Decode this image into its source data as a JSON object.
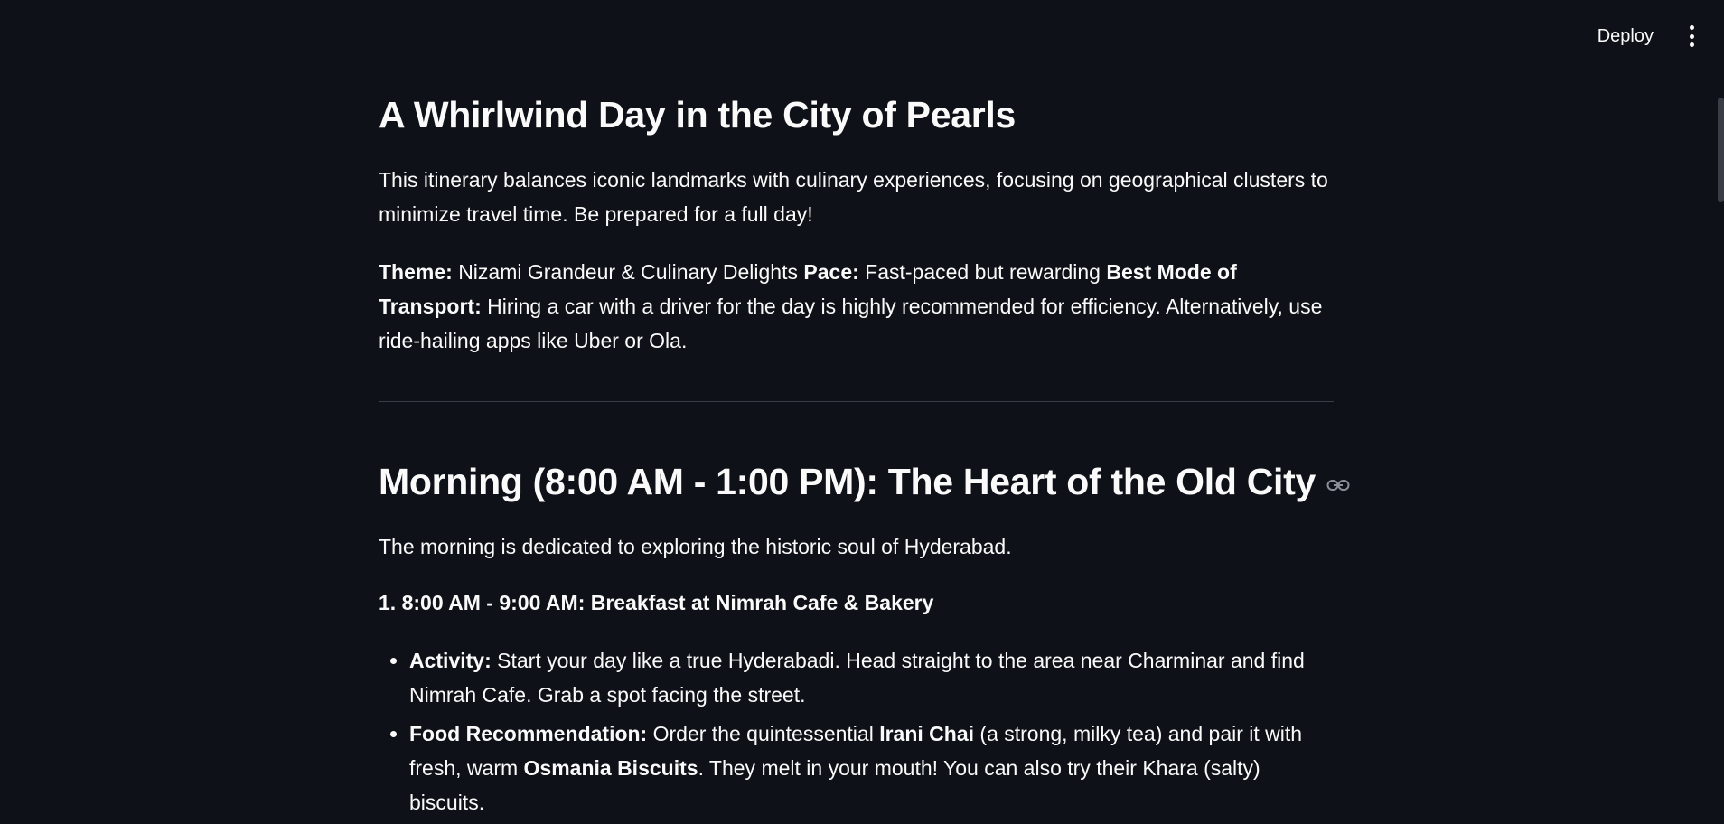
{
  "toolbar": {
    "deploy_label": "Deploy"
  },
  "content": {
    "title": "A Whirlwind Day in the City of Pearls",
    "intro": "This itinerary balances iconic landmarks with culinary experiences, focusing on geographical clusters to minimize travel time. Be prepared for a full day!",
    "theme_label": "Theme:",
    "theme_value": "Nizami Grandeur & Culinary Delights",
    "pace_label": "Pace:",
    "pace_value": "Fast-paced but rewarding",
    "transport_label": "Best Mode of Transport:",
    "transport_value": "Hiring a car with a driver for the day is highly recommended for efficiency. Alternatively, use ride-hailing apps like Uber or Ola.",
    "morning_heading": "Morning (8:00 AM - 1:00 PM): The Heart of the Old City",
    "morning_intro": "The morning is dedicated to exploring the historic soul of Hyderabad.",
    "step1_heading": "1. 8:00 AM - 9:00 AM: Breakfast at Nimrah Cafe & Bakery",
    "bullets": {
      "activity_label": "Activity:",
      "activity_text": "Start your day like a true Hyderabadi. Head straight to the area near Charminar and find Nimrah Cafe. Grab a spot facing the street.",
      "food_label": "Food Recommendation:",
      "food_text_1": "Order the quintessential",
      "food_bold_1": "Irani Chai",
      "food_text_2": "(a strong, milky tea) and pair it with fresh, warm",
      "food_bold_2": "Osmania Biscuits",
      "food_text_3": ". They melt in your mouth! You can also try their Khara (salty) biscuits."
    }
  }
}
